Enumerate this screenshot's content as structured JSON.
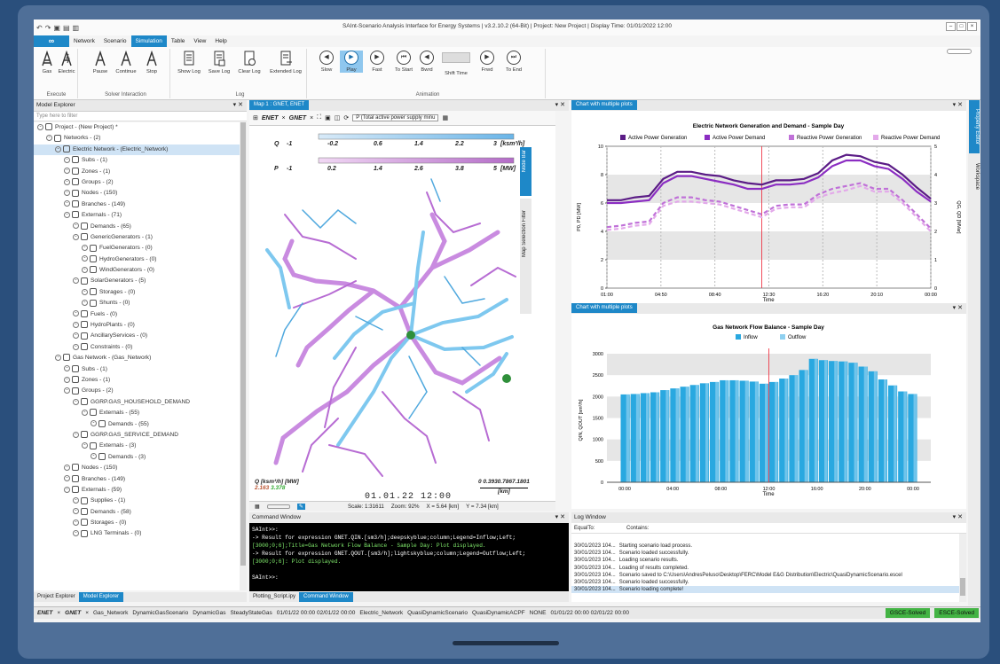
{
  "window": {
    "title": "SAInt-Scenario Analysis Interface for Energy Systems | v3.2.10.2 (64-Bit) | Project: New Project | Display Time: 01/01/2022 12:00"
  },
  "menu": {
    "logo": "∞",
    "items": [
      "Network",
      "Scenario",
      "Simulation",
      "Table",
      "View",
      "Help"
    ],
    "active": "Simulation"
  },
  "ribbon": {
    "execute": {
      "label": "Execute",
      "buttons": [
        "Gas",
        "Electric"
      ]
    },
    "solver": {
      "label": "Solver Interaction",
      "buttons": [
        "Pause",
        "Continue",
        "Stop"
      ]
    },
    "log": {
      "label": "Log",
      "buttons": [
        "Show Log",
        "Save Log",
        "Clear Log",
        "Extended Log"
      ]
    },
    "animation": {
      "label": "Animation",
      "buttons": [
        "Slow",
        "Play",
        "Fast",
        "To Start",
        "Bwrd",
        "Shift Time",
        "Frwd",
        "To End"
      ],
      "active": "Play"
    }
  },
  "model_explorer": {
    "title": "Model Explorer",
    "filter_placeholder": "Type here to filter",
    "rows": [
      {
        "indent": 0,
        "text": "Project - (New Project) *"
      },
      {
        "indent": 1,
        "text": "Networks - (2)"
      },
      {
        "indent": 2,
        "text": "Electric Network - (Electric_Network)",
        "selected": true
      },
      {
        "indent": 3,
        "text": "Subs - (1)"
      },
      {
        "indent": 3,
        "text": "Zones - (1)"
      },
      {
        "indent": 3,
        "text": "Groups - (2)"
      },
      {
        "indent": 3,
        "text": "Nodes - (150)"
      },
      {
        "indent": 3,
        "text": "Branches - (149)"
      },
      {
        "indent": 3,
        "text": "Externals - (71)"
      },
      {
        "indent": 4,
        "text": "Demands - (65)"
      },
      {
        "indent": 4,
        "text": "GenericGenerators - (1)"
      },
      {
        "indent": 5,
        "text": "FuelGenerators - (0)"
      },
      {
        "indent": 5,
        "text": "HydroGenerators - (0)"
      },
      {
        "indent": 5,
        "text": "WindGenerators - (0)"
      },
      {
        "indent": 4,
        "text": "SolarGenerators - (5)"
      },
      {
        "indent": 5,
        "text": "Storages - (0)"
      },
      {
        "indent": 5,
        "text": "Shunts - (0)"
      },
      {
        "indent": 4,
        "text": "Fuels - (0)"
      },
      {
        "indent": 4,
        "text": "HydroPlants - (0)"
      },
      {
        "indent": 4,
        "text": "AncillaryServices - (0)"
      },
      {
        "indent": 4,
        "text": "Constraints - (0)"
      },
      {
        "indent": 2,
        "text": "Gas Network - (Gas_Network)"
      },
      {
        "indent": 3,
        "text": "Subs - (1)"
      },
      {
        "indent": 3,
        "text": "Zones - (1)"
      },
      {
        "indent": 3,
        "text": "Groups - (2)"
      },
      {
        "indent": 4,
        "text": "GGRP.GAS_HOUSEHOLD_DEMAND"
      },
      {
        "indent": 5,
        "text": "Externals - (55)"
      },
      {
        "indent": 6,
        "text": "Demands - (55)"
      },
      {
        "indent": 4,
        "text": "GGRP.GAS_SERVICE_DEMAND"
      },
      {
        "indent": 5,
        "text": "Externals - (3)"
      },
      {
        "indent": 6,
        "text": "Demands - (3)"
      },
      {
        "indent": 3,
        "text": "Nodes - (150)"
      },
      {
        "indent": 3,
        "text": "Branches - (149)"
      },
      {
        "indent": 3,
        "text": "Externals - (59)"
      },
      {
        "indent": 4,
        "text": "Supplies - (1)"
      },
      {
        "indent": 4,
        "text": "Demands - (58)"
      },
      {
        "indent": 4,
        "text": "Storages - (0)"
      },
      {
        "indent": 4,
        "text": "LNG Terminals - (0)"
      }
    ],
    "tabs": [
      "Project Explorer",
      "Model Explorer"
    ]
  },
  "map": {
    "tab": "Map 1 : GNET, ENET",
    "toolbar": {
      "enet": "ENET",
      "gnet": "GNET",
      "dropdown": "P (Total active power supply minu"
    },
    "q_legend": {
      "label": "Q",
      "ticks": [
        "-1",
        "-0.2",
        "0.6",
        "1.4",
        "2.2",
        "3"
      ],
      "unit": "[ksm³/h]"
    },
    "p_legend": {
      "label": "P",
      "ticks": [
        "-1",
        "0.2",
        "1.4",
        "2.6",
        "3.8",
        "5"
      ],
      "unit": "[MW]"
    },
    "bottom_legend": {
      "label": "Q [ksm³/h] [MW]",
      "v1": "2.163",
      "v2": "3.378"
    },
    "scale_bar": {
      "ticks": "0 0.3930.7867.1801",
      "unit": "[km]"
    },
    "time": "01.01.22  12:00",
    "side_tabs": [
      "Node Bar",
      "Map Selection Filter"
    ],
    "status": {
      "scale": "Scale: 1:31611",
      "zoom": "Zoom: 92%",
      "x": "X = 5.64 [km]",
      "y": "Y = 7.34 [km]"
    }
  },
  "charts_panel": [
    {
      "tab": "Chart with multiple plots",
      "chart_data": {
        "type": "line",
        "title": "Electric Network Generation and Demand - Sample Day",
        "xlabel": "Time",
        "ylabel": "P0, PD [MW]",
        "y2label": "QG, QD [MVar]",
        "ylim": [
          0,
          10
        ],
        "y2lim": [
          0,
          5
        ],
        "xticks": [
          "01:00",
          "04:50",
          "08:40",
          "12:30",
          "16:20",
          "20:10",
          "00:00"
        ],
        "y1ticks": [
          "0",
          "2",
          "4",
          "6",
          "8",
          "10"
        ],
        "y2ticks": [
          "0",
          "1",
          "2",
          "3",
          "4",
          "5"
        ],
        "marker_x": 12.0,
        "x": [
          1,
          2,
          3,
          4,
          5,
          6,
          7,
          8,
          9,
          10,
          11,
          12,
          13,
          14,
          15,
          16,
          17,
          18,
          19,
          20,
          21,
          22,
          23,
          24
        ],
        "series": [
          {
            "name": "Active Power Generation",
            "color": "#5b1c86",
            "axis": "left",
            "dash": false,
            "values": [
              6.2,
              6.2,
              6.4,
              6.5,
              7.7,
              8.2,
              8.2,
              8.0,
              7.9,
              7.6,
              7.4,
              7.3,
              7.6,
              7.6,
              7.7,
              8.1,
              9.0,
              9.4,
              9.3,
              8.9,
              8.7,
              8.0,
              7.1,
              6.3
            ]
          },
          {
            "name": "Active Power Demand",
            "color": "#8b2dc2",
            "axis": "left",
            "dash": false,
            "values": [
              6.0,
              6.0,
              6.1,
              6.2,
              7.4,
              7.9,
              7.9,
              7.7,
              7.5,
              7.3,
              7.0,
              7.0,
              7.3,
              7.3,
              7.4,
              7.8,
              8.6,
              9.0,
              9.0,
              8.6,
              8.4,
              7.7,
              6.8,
              6.1
            ]
          },
          {
            "name": "Reactive Power Generation",
            "color": "#c071d8",
            "axis": "right",
            "dash": true,
            "values": [
              2.15,
              2.2,
              2.3,
              2.35,
              3.0,
              3.2,
              3.2,
              3.1,
              3.05,
              2.9,
              2.75,
              2.6,
              2.9,
              2.95,
              2.95,
              3.3,
              3.5,
              3.6,
              3.7,
              3.5,
              3.5,
              3.1,
              2.6,
              2.1
            ]
          },
          {
            "name": "Reactive Power Demand",
            "color": "#e3a9ea",
            "axis": "right",
            "dash": true,
            "values": [
              2.05,
              2.1,
              2.2,
              2.25,
              2.9,
              3.05,
              3.05,
              3.0,
              2.95,
              2.8,
              2.65,
              2.5,
              2.8,
              2.85,
              2.85,
              3.2,
              3.35,
              3.45,
              3.6,
              3.4,
              3.4,
              3.0,
              2.5,
              2.0
            ]
          }
        ]
      }
    },
    {
      "tab": "Chart with multiple plots",
      "chart_data": {
        "type": "bar",
        "title": "Gas Network Flow Balance - Sample Day",
        "xlabel": "Time",
        "ylabel": "QIN, QOUT [sm³/h]",
        "ylim": [
          0,
          3000
        ],
        "yticks": [
          "0",
          "500",
          "1000",
          "1500",
          "2000",
          "2500",
          "3000"
        ],
        "xticks": [
          "00:00",
          "04:00",
          "08:00",
          "12:00",
          "16:00",
          "20:00",
          "00:00"
        ],
        "marker_x": 12,
        "series": [
          {
            "name": "Inflow",
            "color": "#29a8e0",
            "values": [
              2050,
              2060,
              2080,
              2100,
              2150,
              2190,
              2230,
              2270,
              2310,
              2340,
              2380,
              2380,
              2370,
              2350,
              2300,
              2340,
              2420,
              2500,
              2620,
              2880,
              2850,
              2830,
              2820,
              2790,
              2700,
              2590,
              2400,
              2260,
              2120,
              2060
            ]
          },
          {
            "name": "Outflow",
            "color": "#8ed0f0",
            "values": [
              2050,
              2060,
              2080,
              2100,
              2150,
              2190,
              2230,
              2270,
              2310,
              2340,
              2380,
              2380,
              2370,
              2350,
              2300,
              2340,
              2420,
              2500,
              2620,
              2880,
              2850,
              2830,
              2820,
              2790,
              2700,
              2590,
              2400,
              2260,
              2120,
              2060
            ]
          }
        ]
      }
    }
  ],
  "command_window": {
    "title": "Command Window",
    "lines": [
      {
        "text": "SAInt>>:",
        "green": false
      },
      {
        "text": "        -> Result for expression GNET.QIN.[sm3/h];deepskyblue;column;Legend=Inflow;Left;",
        "green": false
      },
      {
        "text": "[3000;0;6];Title=Gas Network Flow Balance - Sample Day: Plot displayed.",
        "green": true
      },
      {
        "text": "        -> Result for expression GNET.QOUT.[sm3/h];lightskyblue;column;Legend=Outflow;Left;",
        "green": false
      },
      {
        "text": "[3000;0;6]: Plot displayed.",
        "green": true
      },
      {
        "text": "",
        "green": false
      },
      {
        "text": "SAInt>>:",
        "green": false
      }
    ],
    "tabs": [
      "Plotting_Script.ipy",
      "Command Window"
    ]
  },
  "log_window": {
    "title": "Log Window",
    "col1": "EqualTo:",
    "col2": "Contains:",
    "rows": [
      {
        "t": "30/01/2023 104...",
        "m": "Starting scenario load process."
      },
      {
        "t": "30/01/2023 104...",
        "m": "Scenario loaded successfully."
      },
      {
        "t": "30/01/2023 104...",
        "m": "Loading scenario results."
      },
      {
        "t": "30/01/2023 104...",
        "m": "Loading of results completed."
      },
      {
        "t": "30/01/2023 104...",
        "m": "Scenario saved to C:\\Users\\AndresPeluso\\Desktop\\FERC\\Model E&G Distribution\\Electric\\QuasiDynamicScenario.escel"
      },
      {
        "t": "30/01/2023 104...",
        "m": "Scenario loaded successfully."
      },
      {
        "t": "30/01/2023 104...",
        "m": "Scenario loading complete!"
      }
    ]
  },
  "right_tabs": [
    "Property Editor",
    "Workspace"
  ],
  "statusbar": {
    "enet": "ENET",
    "gnet": "GNET",
    "items": [
      "Gas_Network",
      "DynamicGasScenario",
      "DynamicGas",
      "SteadyStateGas",
      "01/01/22 00:00  02/01/22 00:00",
      "Electric_Network",
      "QuasiDynamicScenario",
      "QuasiDynamicACPF",
      "NONE",
      "01/01/22 00:00  02/01/22 00:00"
    ],
    "gas_status": "GSCE-Solved",
    "elec_status": "ESCE-Solved"
  }
}
